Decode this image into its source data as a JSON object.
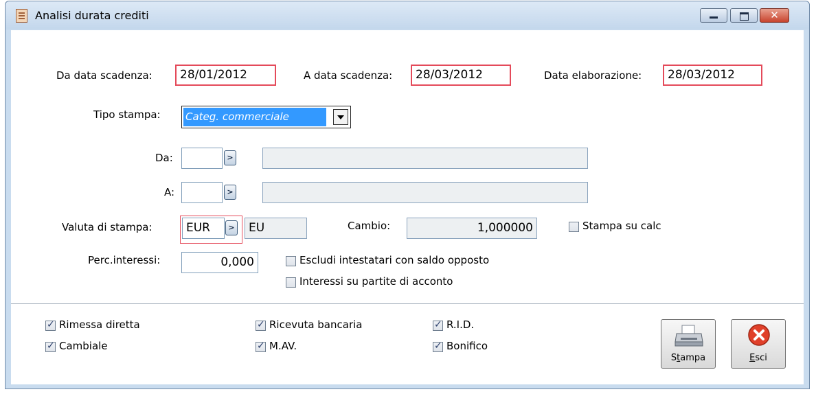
{
  "window": {
    "title": "Analisi durata crediti",
    "buttons": [
      "minimize",
      "maximize",
      "close"
    ]
  },
  "dates": {
    "da_label": "Da data scadenza:",
    "da_value": "28/01/2012",
    "a_label": "A data scadenza:",
    "a_value": "28/03/2012",
    "elab_label": "Data elaborazione:",
    "elab_value": "28/03/2012"
  },
  "tipo_stampa": {
    "label": "Tipo stampa:",
    "value": "Categ. commerciale"
  },
  "range": {
    "da_label": "Da:",
    "a_label": "A:",
    "da_code": "",
    "da_desc": "",
    "a_code": "",
    "a_desc": ""
  },
  "valuta": {
    "label": "Valuta di stampa:",
    "code": "EUR",
    "desc": "EU",
    "cambio_label": "Cambio:",
    "cambio_value": "1,000000",
    "stampa_calc_label": "Stampa su calc",
    "stampa_calc_checked": false
  },
  "interessi": {
    "perc_label": "Perc.interessi:",
    "perc_value": "0,000",
    "escludi_label": "Escludi intestatari con saldo opposto",
    "escludi_checked": false,
    "acconto_label": "Interessi su partite di acconto",
    "acconto_checked": false
  },
  "payment_types": [
    {
      "label": "Rimessa diretta",
      "checked": true
    },
    {
      "label": "Cambiale",
      "checked": true
    },
    {
      "label": "Ricevuta bancaria",
      "checked": true
    },
    {
      "label": "M.AV.",
      "checked": true
    },
    {
      "label": "R.I.D.",
      "checked": true
    },
    {
      "label": "Bonifico",
      "checked": true
    }
  ],
  "actions": {
    "stampa_pre": "S",
    "stampa_ul": "t",
    "stampa_post": "ampa",
    "esci_pre": "",
    "esci_ul": "E",
    "esci_post": "sci"
  },
  "colors": {
    "required_border": "#e44a5a",
    "selection": "#3399ff",
    "frame": "#c9dcef"
  }
}
